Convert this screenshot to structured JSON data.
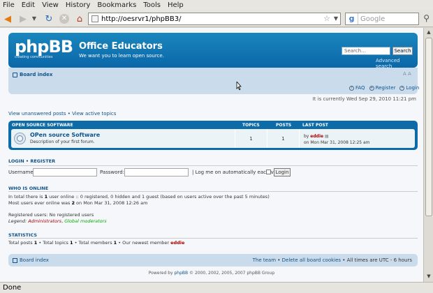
{
  "browser": {
    "menu": [
      "File",
      "Edit",
      "View",
      "History",
      "Bookmarks",
      "Tools",
      "Help"
    ],
    "url": "http://oesrvr1/phpBB3/",
    "search_placeholder": "Google",
    "status": "Done"
  },
  "header": {
    "logo_text": "phpBB",
    "logo_tagline": "creating communities",
    "site_title": "Office Educators",
    "site_description": "We want you to learn open source.",
    "search_placeholder": "Search…",
    "search_button": "Search",
    "advanced_search": "Advanced search"
  },
  "nav": {
    "board_index": "Board index",
    "faq": "FAQ",
    "register": "Register",
    "login": "Login"
  },
  "current_time": "It is currently Wed Sep 29, 2010 11:21 pm",
  "quick_links": {
    "unanswered": "View unanswered posts",
    "separator": " • ",
    "active": "View active topics"
  },
  "forum_table": {
    "headers": {
      "category": "OPEN SOURCE SOFTWARE",
      "topics": "TOPICS",
      "posts": "POSTS",
      "last_post": "LAST POST"
    },
    "row": {
      "title": "OPen source Software",
      "description": "Description of your first forum.",
      "topics": "1",
      "posts": "1",
      "last_post_by": "by",
      "last_post_user": "eddie",
      "last_post_date": "on Mon Mar 31, 2008 12:25 am"
    }
  },
  "login": {
    "title_login": "LOGIN",
    "title_sep": " • ",
    "title_register": "REGISTER",
    "username_label": "Username:",
    "password_label": "Password:",
    "auto_login_label": "| Log me on automatically each visit",
    "button": "Login"
  },
  "who_is_online": {
    "title": "WHO IS ONLINE",
    "line1_pre": "In total there is ",
    "line1_count": "1",
    "line1_post": " user online :: 0 registered, 0 hidden and 1 guest (based on users active over the past 5 minutes)",
    "line2_pre": "Most users ever online was ",
    "line2_count": "2",
    "line2_post": " on Mon Mar 31, 2008 12:26 am",
    "registered": "Registered users: No registered users",
    "legend_label": "Legend: ",
    "legend_admin": "Administrators",
    "legend_sep": ", ",
    "legend_mod": "Global moderators"
  },
  "statistics": {
    "title": "STATISTICS",
    "posts_label": "Total posts ",
    "posts": "1",
    "topics_label": " • Total topics ",
    "topics": "1",
    "members_label": " • Total members ",
    "members": "1",
    "newest_label": " • Our newest member ",
    "newest": "eddie"
  },
  "footer": {
    "board_index": "Board index",
    "team": "The team",
    "sep": " • ",
    "delete_cookies": "Delete all board cookies",
    "times": " • All times are UTC - 6 hours",
    "powered_pre": "Powered by ",
    "powered_link": "phpBB",
    "powered_post": " © 2000, 2002, 2005, 2007 phpBB Group"
  }
}
